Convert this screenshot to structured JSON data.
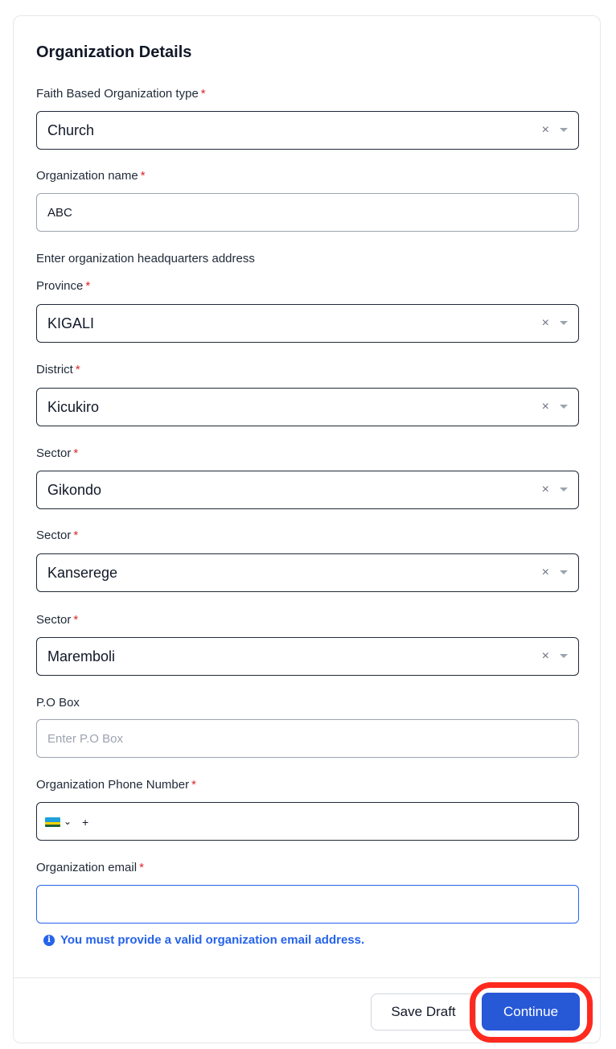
{
  "form": {
    "title": "Organization Details",
    "org_type": {
      "label": "Faith Based Organization type",
      "required": "*",
      "value": "Church"
    },
    "org_name": {
      "label": "Organization name",
      "required": "*",
      "value": "ABC"
    },
    "address_heading": "Enter organization headquarters address",
    "province": {
      "label": "Province",
      "required": "*",
      "value": "KIGALI"
    },
    "district": {
      "label": "District",
      "required": "*",
      "value": "Kicukiro"
    },
    "sector": {
      "label": "Sector",
      "required": "*",
      "value": "Gikondo"
    },
    "cell": {
      "label": "Sector",
      "required": "*",
      "value": "Kanserege"
    },
    "village": {
      "label": "Sector",
      "required": "*",
      "value": "Maremboli"
    },
    "po_box": {
      "label": "P.O Box",
      "placeholder": "Enter P.O Box"
    },
    "phone": {
      "label": "Organization Phone Number",
      "required": "*",
      "prefix": "+",
      "country_flag": "rwanda-flag-icon"
    },
    "email": {
      "label": "Organization email",
      "required": "*",
      "value": ""
    },
    "email_helper": "You must provide a valid organization email address.",
    "clear_symbol": "×",
    "info_symbol": "i",
    "chevron_symbol": "⌄"
  },
  "footer": {
    "save_draft_label": "Save Draft",
    "continue_label": "Continue"
  },
  "colors": {
    "primary": "#2758d6",
    "required": "#dc2626",
    "highlight": "#ff2a1f",
    "helper": "#2563eb"
  }
}
